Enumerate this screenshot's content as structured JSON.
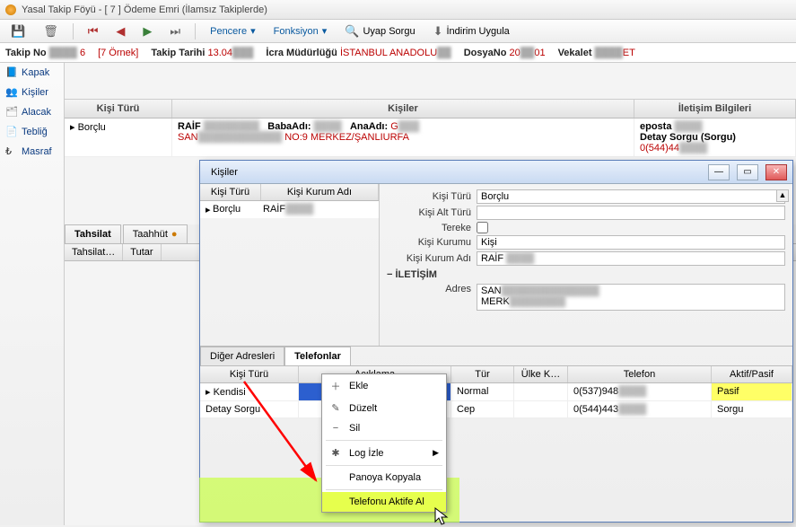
{
  "window": {
    "title": "Yasal Takip Föyü - [ 7 ] Ödeme Emri (İlamsız Takiplerde)"
  },
  "toolbar": {
    "pencere": "Pencere",
    "fonksiyon": "Fonksiyon",
    "uyap": "Uyap Sorgu",
    "indirim": "İndirim Uygula"
  },
  "info": {
    "takip_no_lbl": "Takip No",
    "takip_no_val": "6",
    "ornek": "[7 Örnek]",
    "tarih_lbl": "Takip Tarihi",
    "tarih_val": "13.04",
    "mudurluk_lbl": "İcra Müdürlüğü",
    "mudurluk_val": "İSTANBUL ANADOLU",
    "dosya_lbl": "DosyaNo",
    "dosya_val1": "20",
    "dosya_val2": "01",
    "vekalet_lbl": "Vekalet",
    "vekalet_val": "ET"
  },
  "nav": {
    "kapak": "Kapak",
    "kisiler": "Kişiler",
    "alacak": "Alacak",
    "teblig": "Tebliğ",
    "masraf": "Masraf"
  },
  "grid": {
    "h1": "Kişi Türü",
    "h2": "Kişiler",
    "h3": "İletişim Bilgileri",
    "r1_type": "Borçlu",
    "r1_name": "RAİF",
    "r1_baba_lbl": "BabaAdı:",
    "r1_ana_lbl": "AnaAdı:",
    "r1_ana": "G",
    "r1_addr": "SAN",
    "r1_addr2": "NO:9 MERKEZ/ŞANLIURFA",
    "r1_eposta_lbl": "eposta",
    "r1_detay_lbl": "Detay Sorgu (Sorgu)",
    "r1_tel": "0(544)44"
  },
  "lowtabs": {
    "tahsilat": "Tahsilat",
    "taahhut": "Taahhüt",
    "sub_tahsilat": "Tahsilat…",
    "sub_tutar": "Tutar"
  },
  "modal": {
    "title": "Kişiler",
    "mh1": "Kişi Türü",
    "mh2": "Kişi Kurum Adı",
    "row_type": "Borçlu",
    "row_name": "RAİF",
    "f_kisituru_lbl": "Kişi Türü",
    "f_kisituru": "Borçlu",
    "f_altturu_lbl": "Kişi Alt Türü",
    "f_altturu": "",
    "f_tereke_lbl": "Tereke",
    "f_kurum_lbl": "Kişi Kurumu",
    "f_kurum": "Kişi",
    "f_kurumadi_lbl": "Kişi Kurum Adı",
    "f_kurumadi": "RAİF",
    "iletisim": "İLETİŞİM",
    "f_adres_lbl": "Adres",
    "f_adres1": "SAN",
    "f_adres2": "MERK"
  },
  "ptabs": {
    "diger": "Diğer Adresleri",
    "tel": "Telefonlar"
  },
  "phead": {
    "c1": "Kişi Türü",
    "c2": "Açıklama",
    "c3": "Tür",
    "c4": "Ülke K…",
    "c5": "Telefon",
    "c6": "Aktif/Pasif"
  },
  "prows": [
    {
      "type": "Kendisi",
      "aciklama": "",
      "tur": "Normal",
      "ulke": "",
      "tel": "0(537)948",
      "durum": "Pasif"
    },
    {
      "type": "Detay Sorgu",
      "aciklama": "",
      "tur": "Cep",
      "ulke": "",
      "tel": "0(544)443",
      "durum": "Sorgu"
    }
  ],
  "ctx": {
    "ekle": "Ekle",
    "duzelt": "Düzelt",
    "sil": "Sil",
    "log": "Log İzle",
    "pano": "Panoya Kopyala",
    "aktif": "Telefonu Aktife Al"
  }
}
